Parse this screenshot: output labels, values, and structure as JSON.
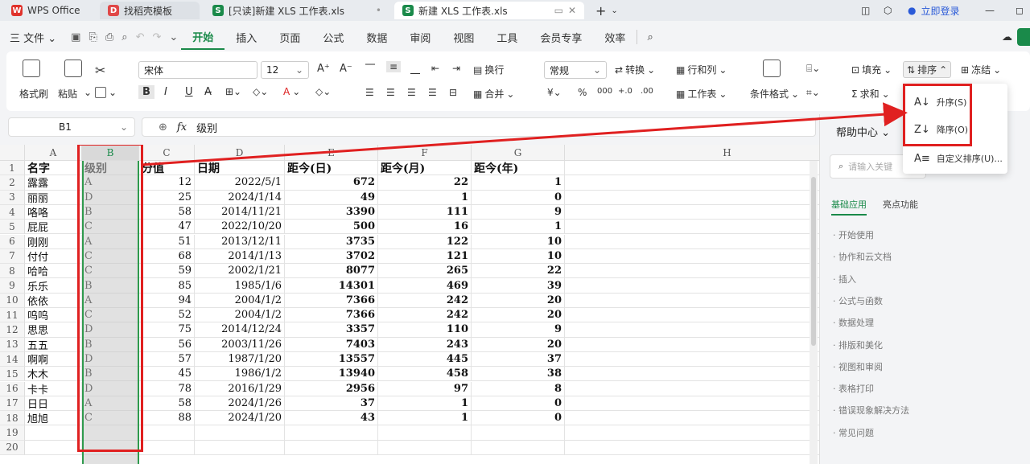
{
  "tabs": [
    {
      "label": "WPS Office",
      "logo": "W",
      "color": "#e0332c"
    },
    {
      "label": "找稻壳模板",
      "logo": "D",
      "color": "#e04848"
    },
    {
      "label": "[只读]新建 XLS 工作表.xls",
      "logo": "S",
      "color": "#1a8a4a"
    },
    {
      "label": "新建 XLS 工作表.xls",
      "logo": "S",
      "color": "#1a8a4a"
    }
  ],
  "login": "立即登录",
  "menu": {
    "file": "三 文件 ⌄",
    "items": [
      "开始",
      "插入",
      "页面",
      "公式",
      "数据",
      "审阅",
      "视图",
      "工具",
      "会员专享",
      "效率"
    ]
  },
  "ribbon": {
    "format_painter": "格式刷",
    "paste": "粘贴",
    "font_name": "宋体",
    "font_size": "12",
    "wrap": "换行",
    "merge": "合并",
    "number_format": "常规",
    "convert": "转换",
    "row_col": "行和列",
    "worksheet": "工作表",
    "cond_format": "条件格式",
    "fill": "填充",
    "sort": "排序",
    "freeze": "冻结",
    "sum": "求和"
  },
  "namebox": "B1",
  "formula_value": "级别",
  "columns": [
    "A",
    "B",
    "C",
    "D",
    "E",
    "F",
    "G",
    "H"
  ],
  "headers": [
    "名字",
    "级别",
    "分值",
    "日期",
    "距今(日)",
    "距今(月)",
    "距今(年)"
  ],
  "rows": [
    [
      "露露",
      "A",
      "12",
      "2022/5/1",
      "672",
      "22",
      "1"
    ],
    [
      "丽丽",
      "D",
      "25",
      "2024/1/14",
      "49",
      "1",
      "0"
    ],
    [
      "咯咯",
      "B",
      "58",
      "2014/11/21",
      "3390",
      "111",
      "9"
    ],
    [
      "屁屁",
      "C",
      "47",
      "2022/10/20",
      "500",
      "16",
      "1"
    ],
    [
      "刚刚",
      "A",
      "51",
      "2013/12/11",
      "3735",
      "122",
      "10"
    ],
    [
      "付付",
      "C",
      "68",
      "2014/1/13",
      "3702",
      "121",
      "10"
    ],
    [
      "哈哈",
      "C",
      "59",
      "2002/1/21",
      "8077",
      "265",
      "22"
    ],
    [
      "乐乐",
      "B",
      "85",
      "1985/1/6",
      "14301",
      "469",
      "39"
    ],
    [
      "依依",
      "A",
      "94",
      "2004/1/2",
      "7366",
      "242",
      "20"
    ],
    [
      "呜呜",
      "C",
      "52",
      "2004/1/2",
      "7366",
      "242",
      "20"
    ],
    [
      "思思",
      "D",
      "75",
      "2014/12/24",
      "3357",
      "110",
      "9"
    ],
    [
      "五五",
      "B",
      "56",
      "2003/11/26",
      "7403",
      "243",
      "20"
    ],
    [
      "啊啊",
      "D",
      "57",
      "1987/1/20",
      "13557",
      "445",
      "37"
    ],
    [
      "木木",
      "B",
      "45",
      "1986/1/2",
      "13940",
      "458",
      "38"
    ],
    [
      "卡卡",
      "D",
      "78",
      "2016/1/29",
      "2956",
      "97",
      "8"
    ],
    [
      "日日",
      "A",
      "58",
      "2024/1/26",
      "37",
      "1",
      "0"
    ],
    [
      "旭旭",
      "C",
      "88",
      "2024/1/20",
      "43",
      "1",
      "0"
    ]
  ],
  "row_numbers": [
    "1",
    "2",
    "3",
    "4",
    "5",
    "6",
    "7",
    "8",
    "9",
    "10",
    "11",
    "12",
    "13",
    "14",
    "15",
    "16",
    "17",
    "18",
    "19",
    "20"
  ],
  "help": {
    "title": "帮助中心",
    "search_placeholder": "请输入关键",
    "tab_basic": "基础应用",
    "tab_feature": "亮点功能",
    "items": [
      "开始使用",
      "协作和云文档",
      "插入",
      "公式与函数",
      "数据处理",
      "排版和美化",
      "视图和审阅",
      "表格打印",
      "错误现象解决方法",
      "常见问题"
    ]
  },
  "sort_menu": {
    "ascending": "升序(S)",
    "descending": "降序(O)",
    "custom": "自定义排序(U)..."
  },
  "colors": {
    "accent": "#1a8a4a",
    "highlight": "#e02020"
  }
}
